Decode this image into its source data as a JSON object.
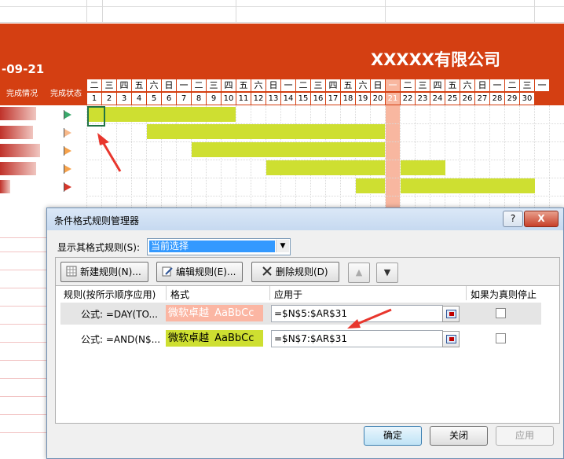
{
  "sheet": {
    "date_fragment": "-09-21",
    "company": "XXXXX有限公司",
    "col_completion": "完成情况",
    "col_status": "完成状态",
    "weekdays": [
      "二",
      "三",
      "四",
      "五",
      "六",
      "日",
      "一",
      "二",
      "三",
      "四",
      "五",
      "六",
      "日",
      "一",
      "二",
      "三",
      "四",
      "五",
      "六",
      "日",
      "一",
      "二",
      "三",
      "四",
      "五",
      "六",
      "日",
      "一",
      "二",
      "三",
      "一"
    ],
    "days": [
      "1",
      "2",
      "3",
      "4",
      "5",
      "6",
      "7",
      "8",
      "9",
      "10",
      "11",
      "12",
      "13",
      "14",
      "15",
      "16",
      "17",
      "18",
      "19",
      "20",
      "21",
      "22",
      "23",
      "24",
      "25",
      "26",
      "27",
      "28",
      "29",
      "30"
    ],
    "today_day": "21",
    "colors": {
      "banner": "#d43f12",
      "gantt": "#cedf31",
      "today": "#f8b7a0",
      "bar": "#c0322a"
    },
    "flags": [
      "green-flag-icon",
      "orange-flag-icon",
      "orange-flag-icon",
      "orange-flag-icon",
      "red-flag-icon"
    ]
  },
  "dialog": {
    "title": "条件格式规则管理器",
    "help_label": "?",
    "close_label": "X",
    "show_rules_label": "显示其格式规则(S):",
    "show_rules_value": "当前选择",
    "new_rule": "新建规则(N)...",
    "edit_rule": "编辑规则(E)...",
    "delete_rule": "删除规则(D)",
    "columns": {
      "rule": "规则(按所示顺序应用)",
      "format": "格式",
      "applies_to": "应用于",
      "stop_if_true": "如果为真则停止"
    },
    "rules": [
      {
        "rule": "公式: =DAY(TO...",
        "preview_text": "微软卓越",
        "preview_sample": "AaBbCc",
        "applies_to": "=$N$5:$AR$31",
        "stop_if_true": false,
        "color": "#fbb6a3"
      },
      {
        "rule": "公式: =AND(N$...",
        "preview_text": "微软卓越",
        "preview_sample": "AaBbCc",
        "applies_to": "=$N$7:$AR$31",
        "stop_if_true": false,
        "color": "#cedf31"
      }
    ],
    "ok": "确定",
    "close": "关闭",
    "apply": "应用"
  }
}
